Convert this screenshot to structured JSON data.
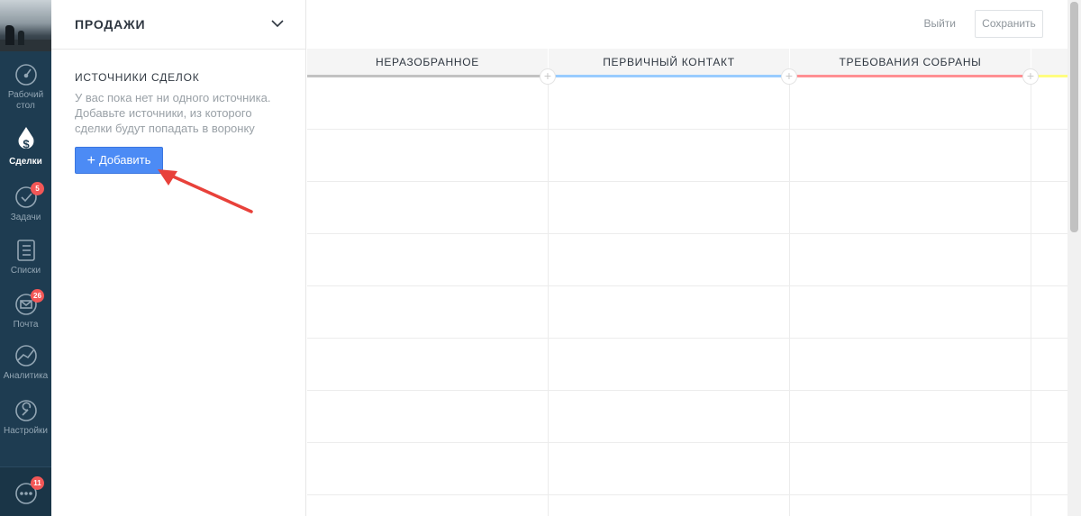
{
  "nav": {
    "items": [
      {
        "label": "Рабочий стол",
        "icon": "dashboard-icon"
      },
      {
        "label": "Сделки",
        "icon": "deals-icon",
        "active": true
      },
      {
        "label": "Задачи",
        "icon": "tasks-icon",
        "badge": "5"
      },
      {
        "label": "Списки",
        "icon": "lists-icon"
      },
      {
        "label": "Почта",
        "icon": "mail-icon",
        "badge": "26"
      },
      {
        "label": "Аналитика",
        "icon": "analytics-icon"
      },
      {
        "label": "Настройки",
        "icon": "settings-icon"
      }
    ],
    "chat": {
      "icon": "chat-icon",
      "badge": "11"
    }
  },
  "panel": {
    "pipeline_title": "ПРОДАЖИ",
    "sources_title": "ИСТОЧНИКИ СДЕЛОК",
    "sources_empty": "У вас пока нет ни одного источника. Добавьте источники, из которого сделки будут попадать в воронку",
    "add_button": "Добавить"
  },
  "toolbar": {
    "logout": "Выйти",
    "save": "Сохранить"
  },
  "board": {
    "columns": [
      {
        "title": "НЕРАЗОБРАННОЕ",
        "color": "#c2c2c2"
      },
      {
        "title": "ПЕРВИЧНЫЙ КОНТАКТ",
        "color": "#99ccff"
      },
      {
        "title": "ТРЕБОВАНИЯ СОБРАНЫ",
        "color": "#ff8f92"
      },
      {
        "title": "",
        "color": "#fffd7f"
      }
    ]
  },
  "colors": {
    "nav_bg": "#1e3c51",
    "accent": "#4c8bf5",
    "badge": "#f25757"
  }
}
